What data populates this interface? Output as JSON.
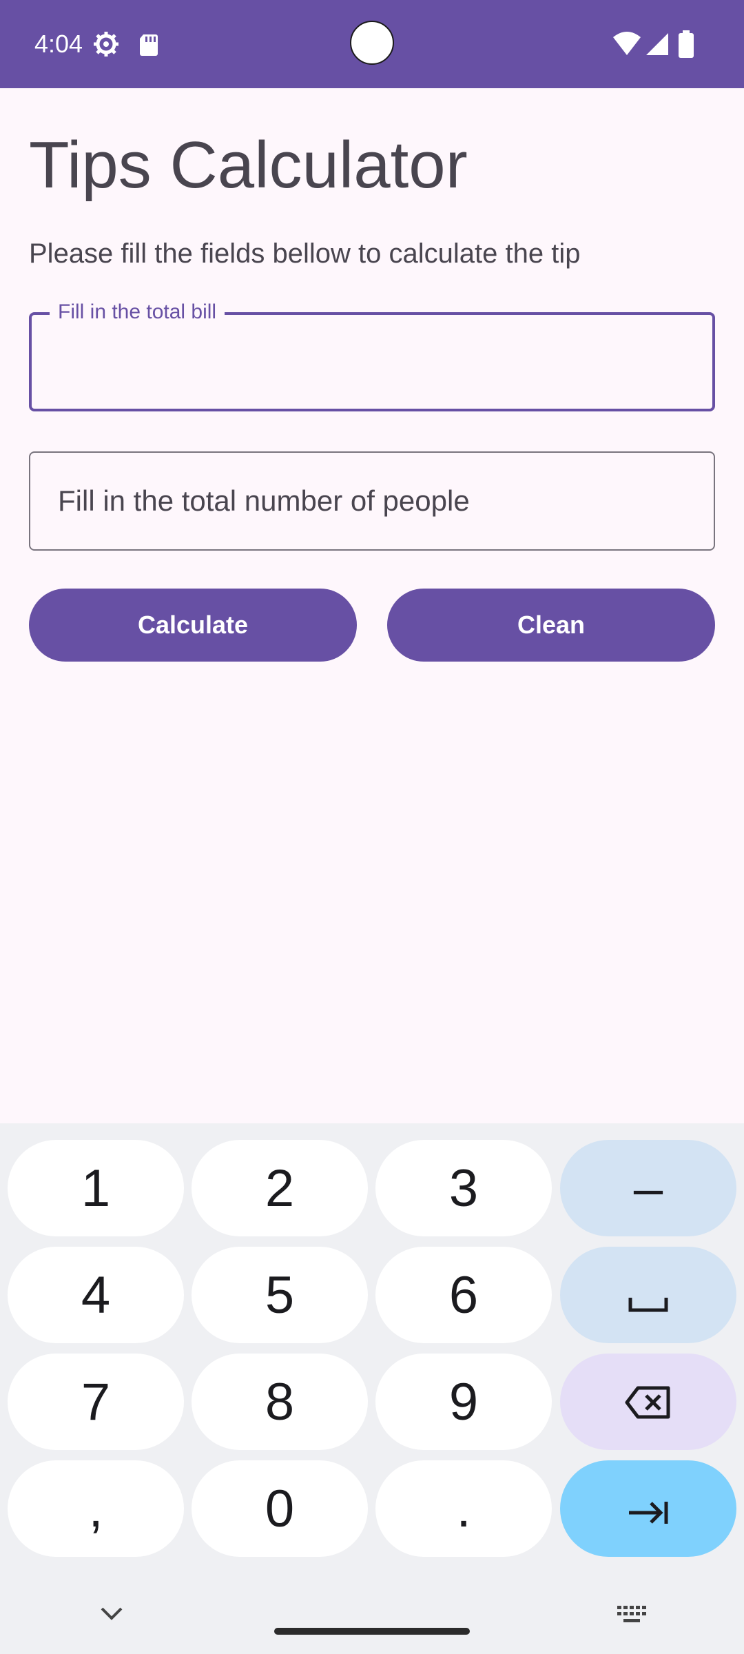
{
  "status_bar": {
    "time": "4:04",
    "icons": [
      "settings-icon",
      "sd-card-icon",
      "wifi-icon",
      "signal-icon",
      "battery-icon"
    ],
    "background": "#6750a4"
  },
  "app": {
    "title": "Tips Calculator",
    "subtitle": "Please fill the fields bellow to calculate the tip",
    "fields": {
      "total_bill": {
        "label": "Fill in the total bill",
        "value": "",
        "focused": true
      },
      "people": {
        "label": "Fill in the total number of people",
        "value": "",
        "focused": false
      }
    },
    "buttons": {
      "calculate": "Calculate",
      "clean": "Clean"
    },
    "accent_color": "#6750a4",
    "background": "#fef7fc"
  },
  "keyboard": {
    "rows": [
      [
        "1",
        "2",
        "3",
        "–"
      ],
      [
        "4",
        "5",
        "6",
        "space-icon"
      ],
      [
        "7",
        "8",
        "9",
        "backspace-icon"
      ],
      [
        ",",
        "0",
        ".",
        "tab-next-icon"
      ]
    ],
    "bottom_icons": [
      "chevron-down-icon",
      "keyboard-icon"
    ]
  }
}
